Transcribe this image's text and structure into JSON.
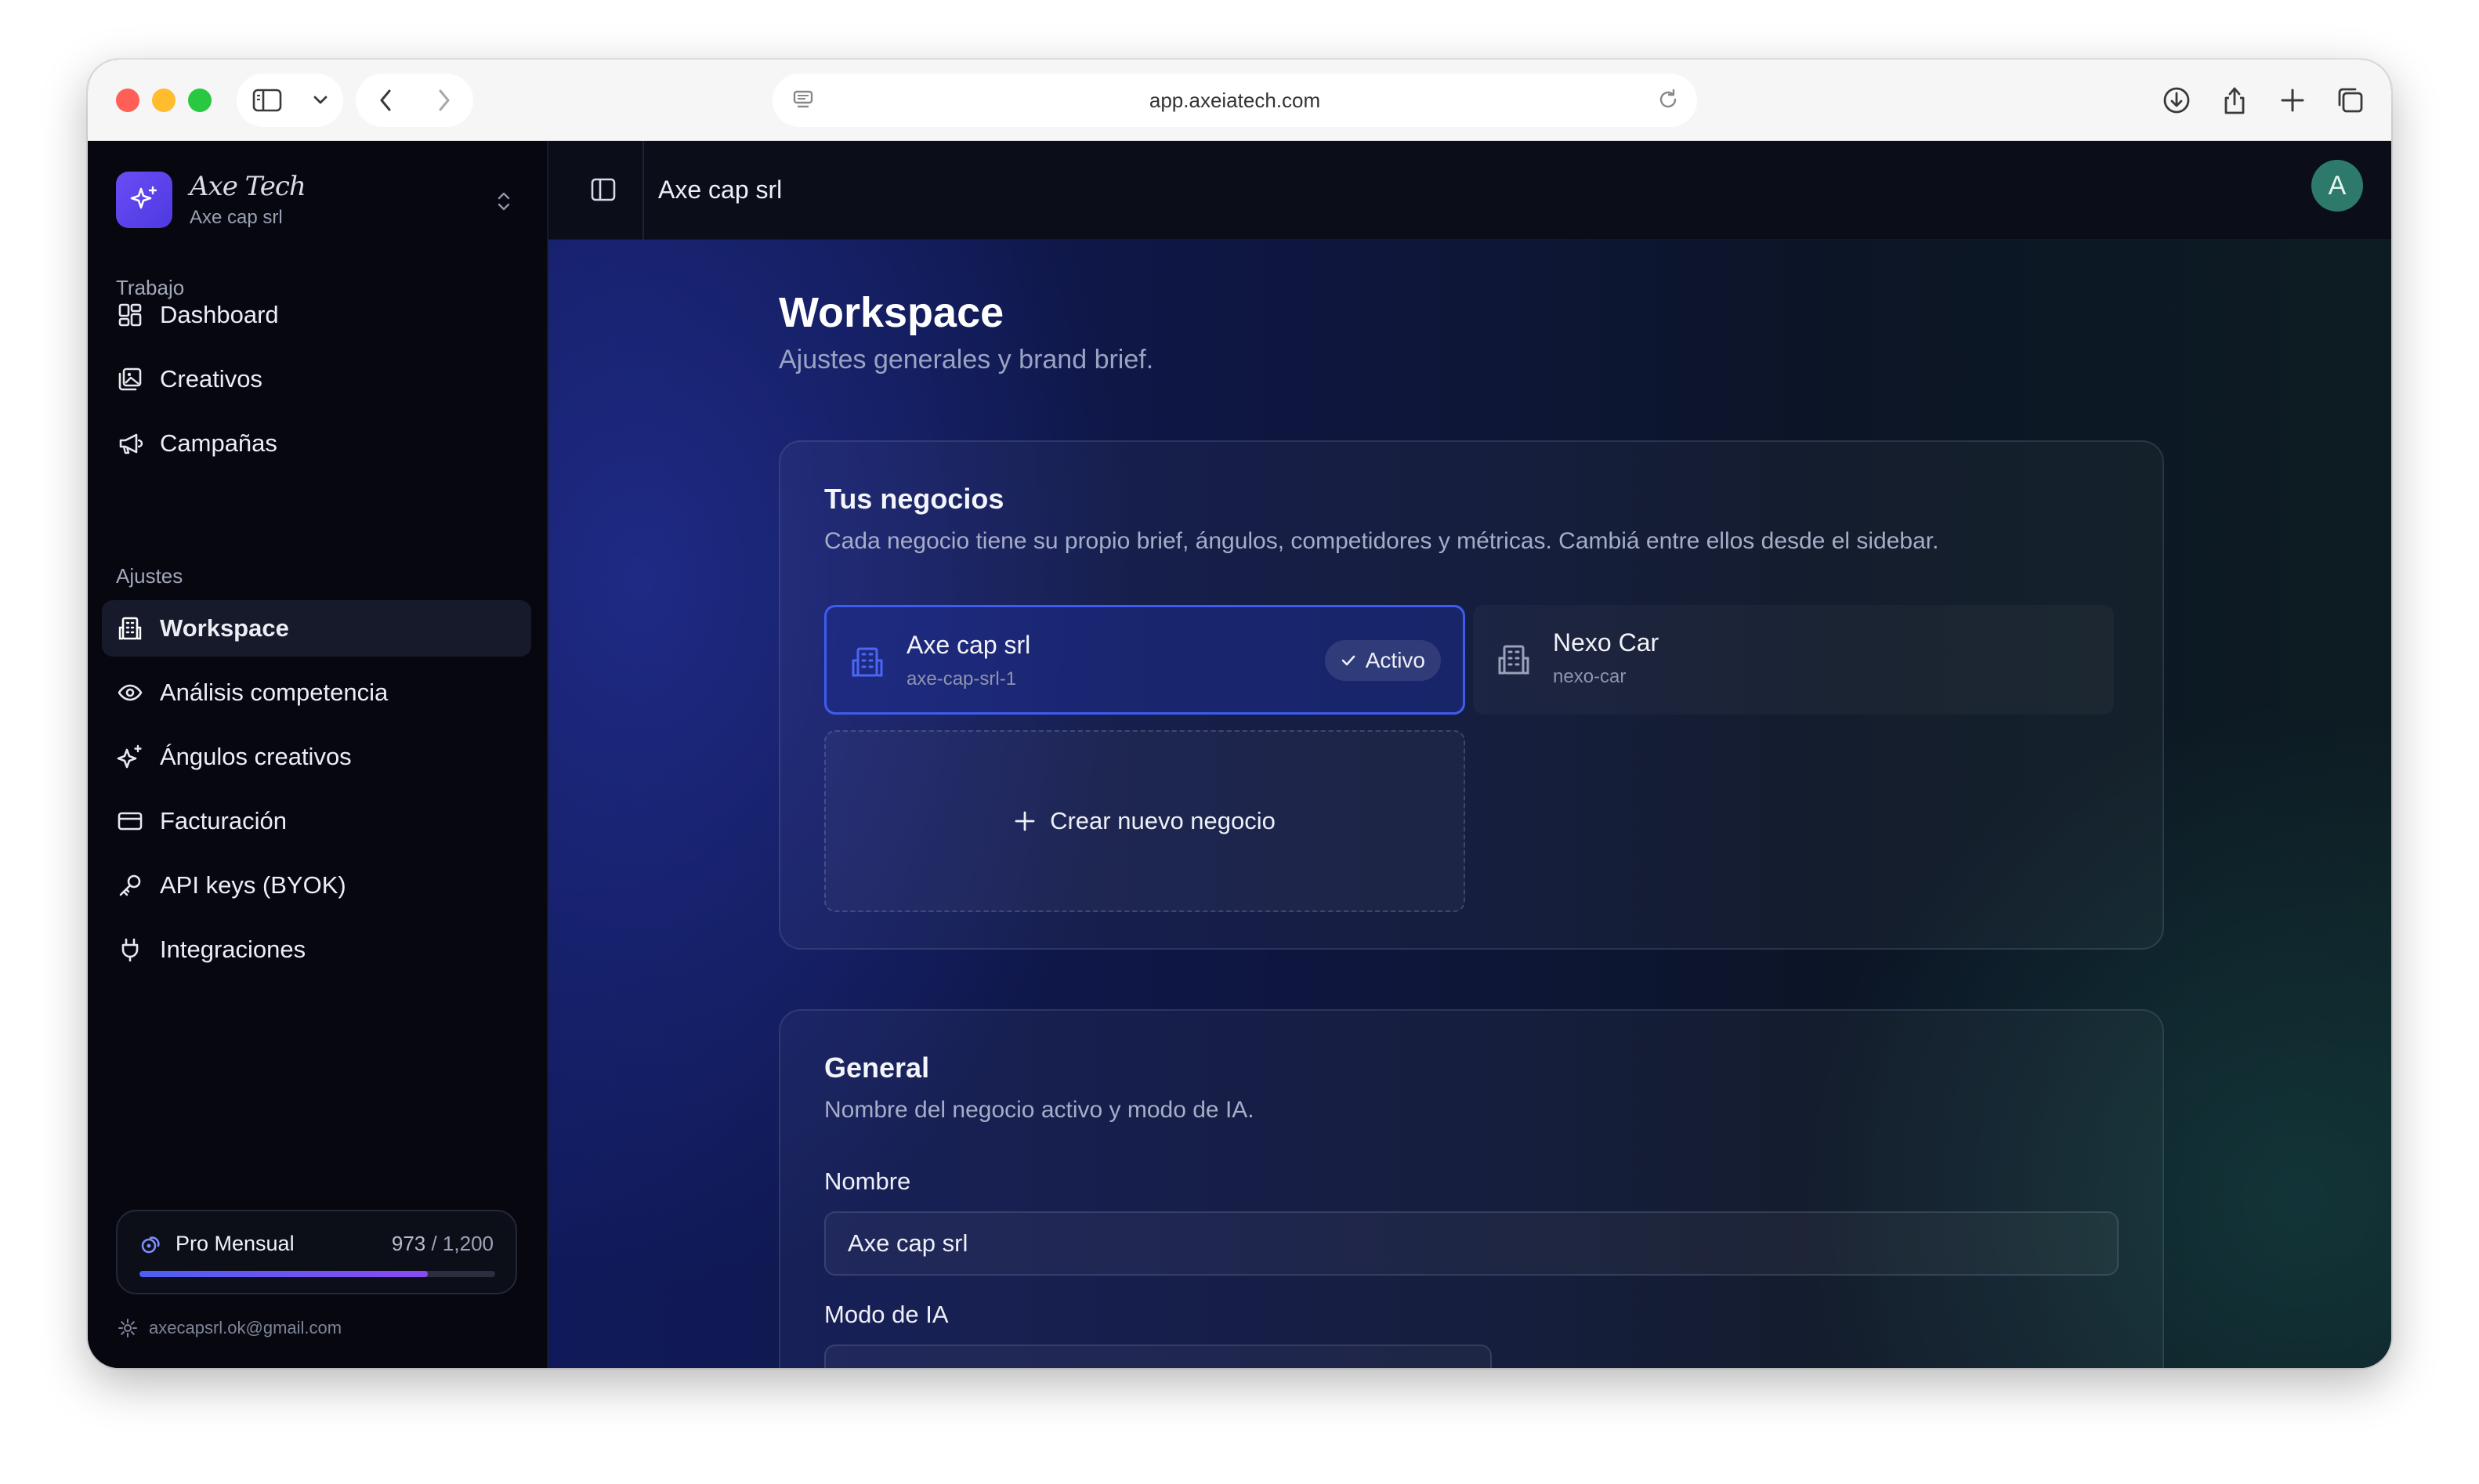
{
  "browser": {
    "url": "app.axeiatech.com"
  },
  "brand": {
    "name": "Axe Tech",
    "workspace": "Axe cap srl"
  },
  "sidebar": {
    "sections": [
      {
        "label": "Trabajo",
        "items": [
          {
            "label": "Dashboard",
            "icon": "dashboard-icon"
          },
          {
            "label": "Creativos",
            "icon": "images-icon"
          },
          {
            "label": "Campañas",
            "icon": "megaphone-icon"
          }
        ]
      },
      {
        "label": "Ajustes",
        "items": [
          {
            "label": "Workspace",
            "icon": "building-icon",
            "active": true
          },
          {
            "label": "Análisis competencia",
            "icon": "eye-icon"
          },
          {
            "label": "Ángulos creativos",
            "icon": "sparkles-icon"
          },
          {
            "label": "Facturación",
            "icon": "credit-card-icon"
          },
          {
            "label": "API keys (BYOK)",
            "icon": "key-icon"
          },
          {
            "label": "Integraciones",
            "icon": "plug-icon"
          }
        ]
      }
    ],
    "plan": {
      "name": "Pro Mensual",
      "used": "973",
      "separator": " / ",
      "limit": "1,200",
      "usage_fraction": 0.81
    },
    "user_email": "axecapsrl.ok@gmail.com"
  },
  "topbar": {
    "breadcrumb": "Axe cap srl",
    "avatar_initial": "A"
  },
  "page": {
    "title": "Workspace",
    "subtitle": "Ajustes generales y brand brief."
  },
  "businesses_card": {
    "title": "Tus negocios",
    "description": "Cada negocio tiene su propio brief, ángulos, competidores y métricas. Cambiá entre ellos desde el sidebar.",
    "businesses": [
      {
        "name": "Axe cap srl",
        "slug": "axe-cap-srl-1",
        "badge": "Activo",
        "active": true
      },
      {
        "name": "Nexo Car",
        "slug": "nexo-car",
        "active": false
      }
    ],
    "create_label": "Crear nuevo negocio"
  },
  "general_card": {
    "title": "General",
    "description": "Nombre del negocio activo y modo de IA.",
    "name_label": "Nombre",
    "name_value": "Axe cap srl",
    "ai_mode_label": "Modo de IA"
  },
  "colors": {
    "accent": "#3f5cf0",
    "brand_logo": "#5b43ea",
    "avatar": "#2d7a6a"
  }
}
